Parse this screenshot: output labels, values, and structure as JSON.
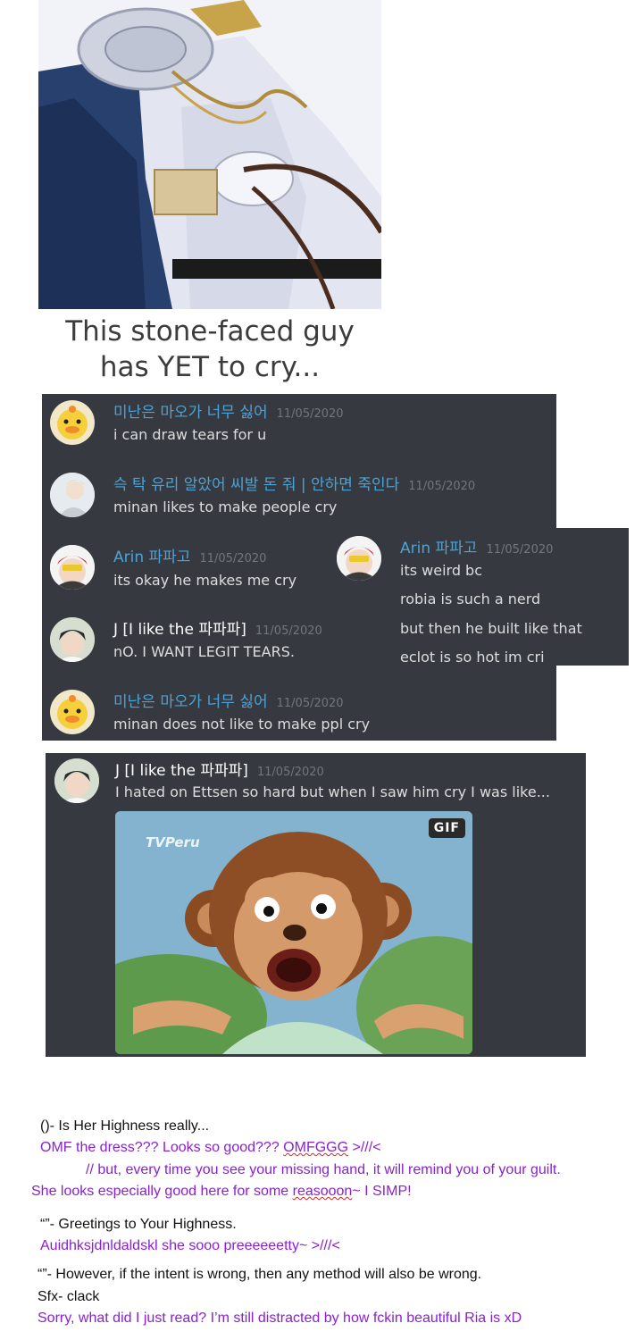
{
  "caption": {
    "line1": "This stone-faced guy",
    "line2": "has YET to cry..."
  },
  "chat1": {
    "messages": [
      {
        "user": "미난은 마오가 너무 싫어",
        "time": "11/05/2020",
        "text": "i can draw tears for u"
      },
      {
        "user": "슥 탁 유리 알았어 씨발 돈 줘 | 안하면 죽인다",
        "time": "11/05/2020",
        "text": "minan likes to make people cry"
      },
      {
        "user": "Arin 파파고",
        "time": "11/05/2020",
        "text": "its okay he makes me cry"
      },
      {
        "user": "J [I like the 파파파]",
        "time": "11/05/2020",
        "text": "nO. I WANT LEGIT TEARS."
      },
      {
        "user": "미난은 마오가 너무 싫어",
        "time": "11/05/2020",
        "text": "minan does not like to make ppl cry"
      }
    ]
  },
  "chat2": {
    "user": "Arin 파파고",
    "time": "11/05/2020",
    "lines": [
      "its weird bc",
      "robia is such a nerd",
      "but then he built like that",
      "eclot is so hot im cri"
    ]
  },
  "chat3": {
    "user": "J [I like the 파파파]",
    "time": "11/05/2020",
    "text": "I hated on Ettsen so hard but when I saw him cry I was like...",
    "gif_badge": "GIF",
    "gif_watermark": "TVPeru"
  },
  "comments": {
    "c1": "()- Is Her Highness really...",
    "c2a": "OMF the dress??? Looks so good??? ",
    "c2b": "OMFGGG",
    "c2c": " >///<",
    "c3": "// but, every time you see your missing hand, it will remind you of your guilt.",
    "c4a": "She looks especially good here for some ",
    "c4b": "reasooon",
    "c4c": "~ I SIMP!",
    "c5": "“”- Greetings to Your Highness.",
    "c6": "Auidhksjdnldaldskl she sooo preeeeeetty~ >///<",
    "c7": "“”- However, if the intent is wrong, then any method will also be wrong.",
    "c8": "Sfx- clack",
    "c9": "Sorry, what did I just read? I’m still distracted by how fckin beautiful Ria is xD"
  },
  "colors": {
    "discord_bg": "#36393f",
    "username_blue": "#4ba3d6",
    "comment_purple": "#8b1fd1"
  }
}
